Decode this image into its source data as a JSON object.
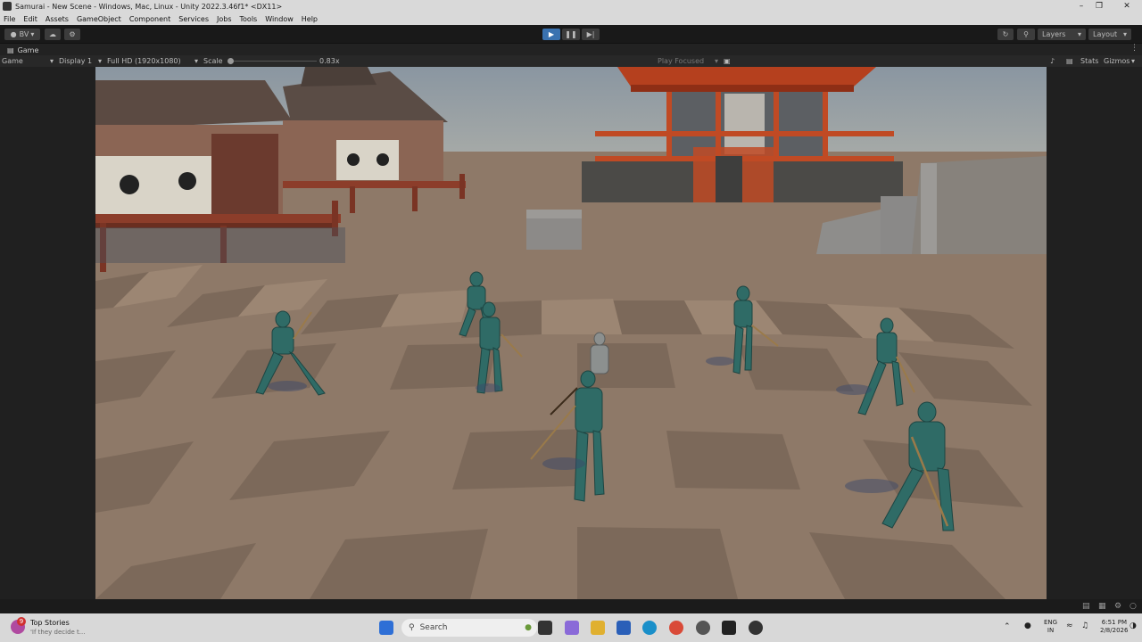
{
  "window": {
    "title": "Samurai - New Scene - Windows, Mac, Linux - Unity 2022.3.46f1* <DX11>"
  },
  "menu": [
    "File",
    "Edit",
    "Assets",
    "GameObject",
    "Component",
    "Services",
    "Jobs",
    "Tools",
    "Window",
    "Help"
  ],
  "toolbar": {
    "account": "BV",
    "layers": "Layers",
    "layout": "Layout"
  },
  "game_view": {
    "tab": "Game",
    "mode": "Game",
    "display": "Display 1",
    "resolution": "Full HD (1920x1080)",
    "scale_label": "Scale",
    "scale_value": "0.83x",
    "play_focused": "Play Focused",
    "stats": "Stats",
    "gizmos": "Gizmos"
  },
  "taskbar": {
    "news_badge": "9",
    "news_title": "Top Stories",
    "news_sub": "'If they decide t...",
    "search_placeholder": "Search",
    "lang_top": "ENG",
    "lang_bottom": "IN",
    "time": "6:51 PM",
    "date": "2/8/2026"
  },
  "colors": {
    "play_active": "#3a72b0",
    "editor_bg": "#1e1e1e",
    "floor_light": "#a8917c",
    "floor_dark": "#6e5d4f",
    "character": "#2f6b66"
  }
}
